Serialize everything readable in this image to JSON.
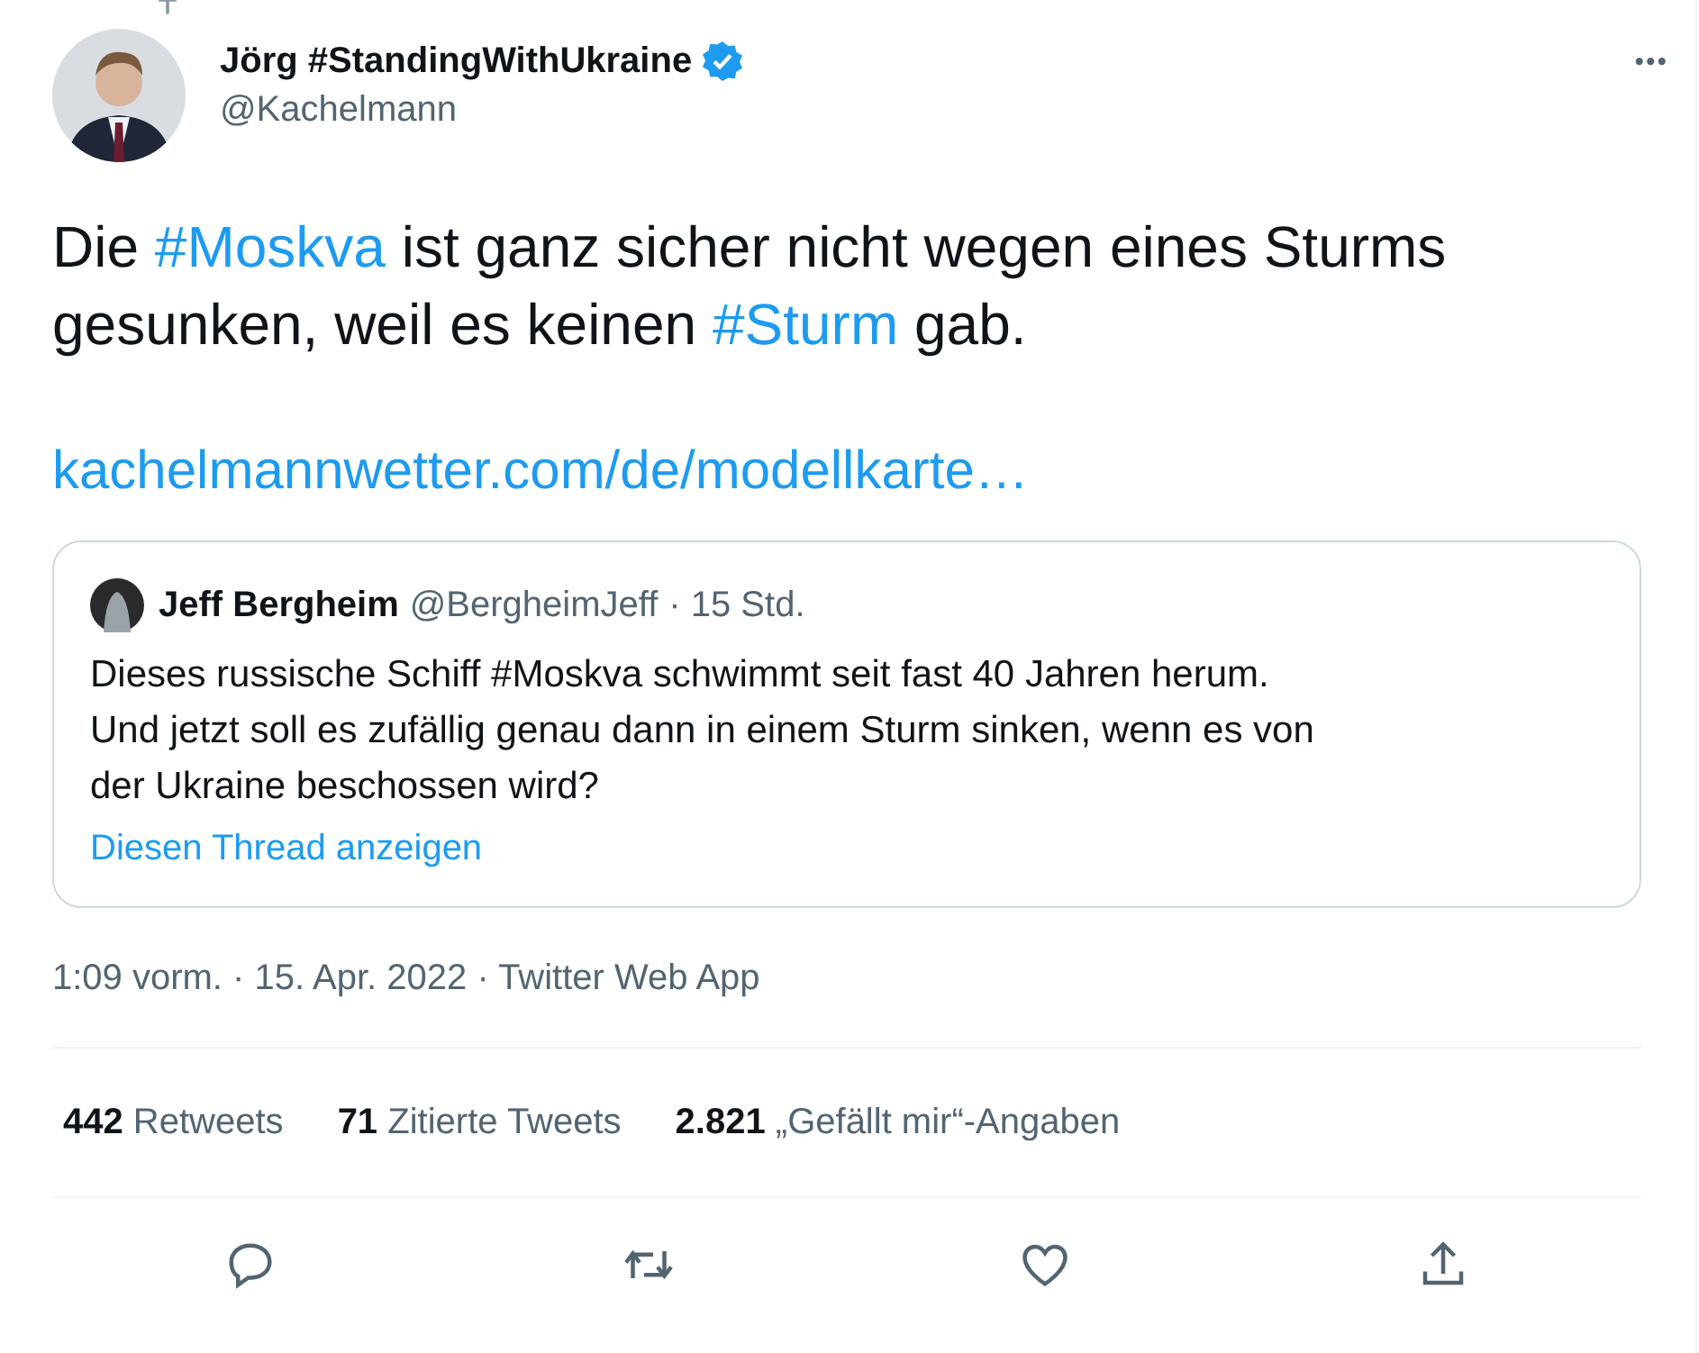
{
  "author": {
    "name": "Jörg #StandingWithUkraine",
    "verified": true,
    "handle": "@Kachelmann"
  },
  "more_button": "•••",
  "tweet_text": [
    {
      "kind": "text",
      "text": "Die "
    },
    {
      "kind": "hashtag",
      "text": "#Moskva"
    },
    {
      "kind": "text",
      "text": " ist ganz sicher nicht wegen eines Sturms gesunken, weil es keinen "
    },
    {
      "kind": "hashtag",
      "text": "#Sturm"
    },
    {
      "kind": "text",
      "text": " gab."
    }
  ],
  "link": "kachelmannwetter.com/de/modellkarte…",
  "quoted_tweet": {
    "name": "Jeff Bergheim",
    "handle": "@BergheimJeff",
    "time": "· 15 Std.",
    "text": "Dieses russische Schiff #Moskva schwimmt seit fast 40 Jahren herum. Und jetzt soll es zufällig genau dann in einem Sturm sinken, wenn es von der Ukraine beschossen wird?",
    "thread_link": "Diesen Thread anzeigen"
  },
  "timestamp": "1:09 vorm. · 15. Apr. 2022 · Twitter Web App",
  "stats": [
    {
      "count": "442",
      "label": "Retweets"
    },
    {
      "count": "71",
      "label": "Zitierte Tweets"
    },
    {
      "count": "2.821",
      "label": "„Gefällt mir“-Angaben"
    }
  ],
  "actions": [
    {
      "kind": "reply"
    },
    {
      "kind": "retweet"
    },
    {
      "kind": "like"
    },
    {
      "kind": "share"
    }
  ]
}
